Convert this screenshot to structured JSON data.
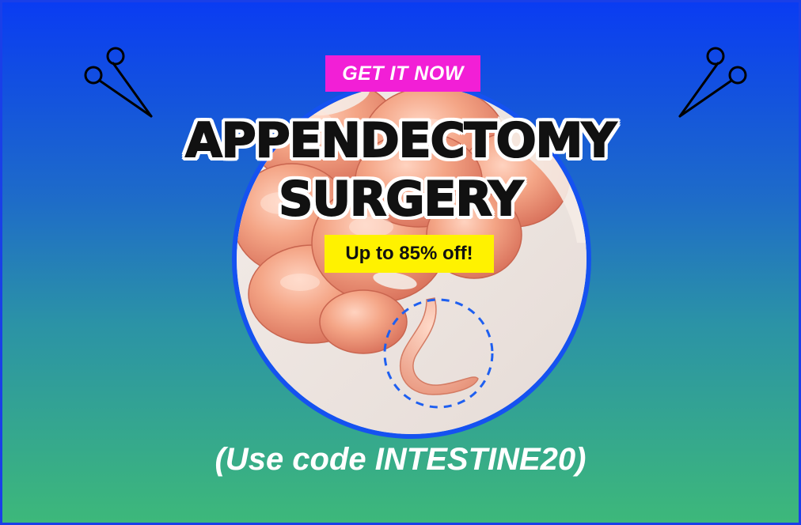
{
  "banner": {
    "cta_label": "GET IT NOW",
    "title_line_1": "APPENDECTOMY",
    "title_line_2": "SURGERY",
    "discount_label": "Up to 85% off!",
    "promo_text": "(Use code INTESTINE20)"
  },
  "icons": {
    "left": "scissors-icon",
    "right": "scissors-icon"
  },
  "colors": {
    "gradient_top": "#0a3cf2",
    "gradient_bottom": "#3db87a",
    "cta_badge": "#f21fd6",
    "discount_badge": "#fff200",
    "circle_border": "#1552f0"
  }
}
